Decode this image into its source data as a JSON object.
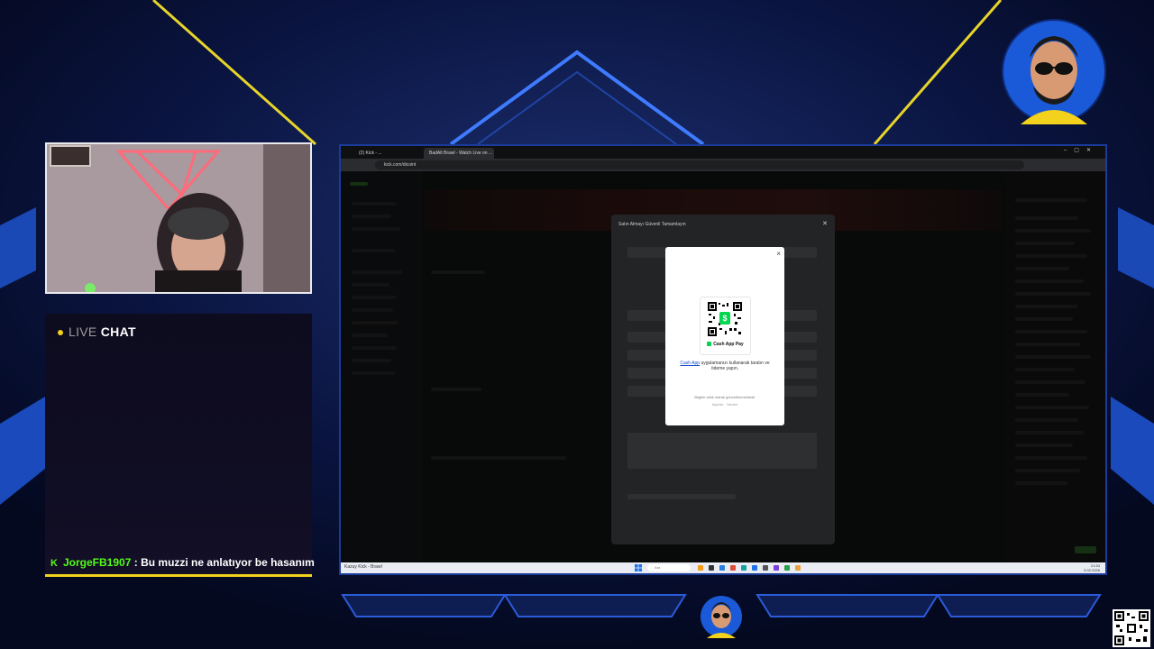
{
  "overlay": {
    "live_label": "LIVE",
    "chat_label": "CHAT",
    "chat_message": {
      "username": "JorgeFB1907",
      "separator": ":",
      "text": "Bu muzzi ne anlatıyor be hasanım"
    },
    "colors": {
      "accent_yellow": "#f2d21c",
      "kick_green": "#53fc18",
      "frame_blue": "#1a3b9a"
    }
  },
  "browser": {
    "tabs": [
      {
        "label": "(2) Kick - ..."
      },
      {
        "label": "BadAlt Brawl - Watch Live on ..."
      }
    ],
    "url": "kick.com/dicoint",
    "window_controls": [
      "–",
      "▢",
      "✕"
    ]
  },
  "dialog": {
    "title": "Satın Almayı Güvenli Tamamlayın",
    "close": "✕"
  },
  "modal": {
    "close": "×",
    "qr_caption": "Cash App Pay",
    "text_link": "Cash App",
    "text_body": " uygulamanızı kullanarak taratın ve ödeme yapın.",
    "foot_line1": "Bilgiler anlık olarak güncellenmektedir",
    "foot_line2": "Ayarlar · Yardım"
  },
  "taskbar": {
    "app_label": "Kazuy Kick - Brawl",
    "search_placeholder": "Ara",
    "clock_time": "21:53",
    "clock_date": "5.02.2026"
  },
  "icons": [
    "kick-logo-icon",
    "close-icon",
    "cash-app-icon",
    "qr-code-icon",
    "windows-start-icon",
    "search-icon",
    "avatar-icon"
  ]
}
